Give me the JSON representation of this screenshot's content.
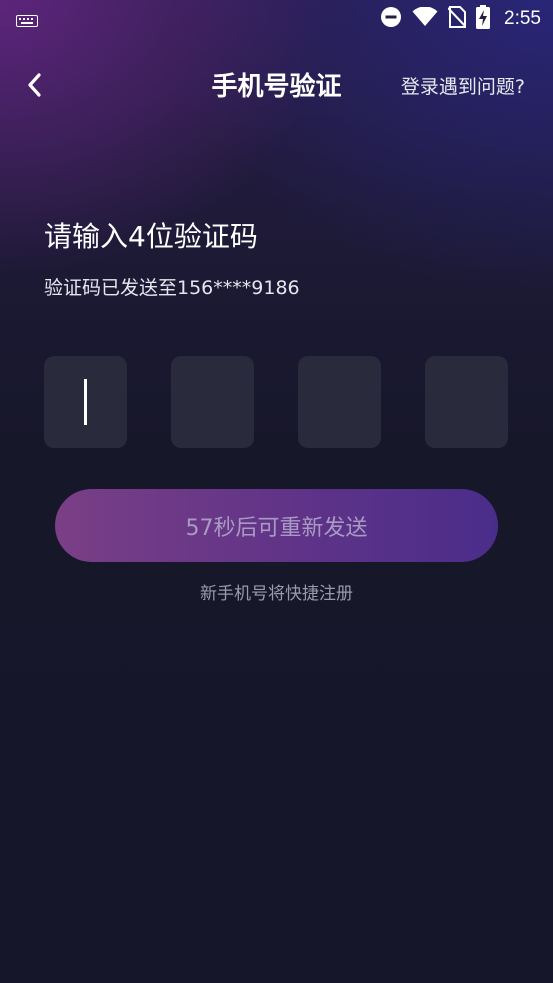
{
  "status_bar": {
    "time": "2:55",
    "icons": [
      "keyboard-icon",
      "dnd-icon",
      "wifi-icon",
      "no-sim-icon",
      "battery-charging-icon"
    ]
  },
  "header": {
    "title": "手机号验证",
    "back_icon": "back-chevron-icon",
    "help_link": "登录遇到问题?"
  },
  "verification": {
    "heading": "请输入4位验证码",
    "sent_to": "验证码已发送至156****9186",
    "code_digits": [
      "",
      "",
      "",
      ""
    ]
  },
  "resend_button": {
    "label": "57秒后可重新发送"
  },
  "note": "新手机号将快捷注册",
  "colors": {
    "background": "#17172a",
    "code_box": "#292a3b",
    "button_gradient_start": "#7a3f86",
    "button_gradient_end": "#4a2d8a",
    "button_text": "#a99ac3",
    "note_text": "#9a9aa8"
  }
}
